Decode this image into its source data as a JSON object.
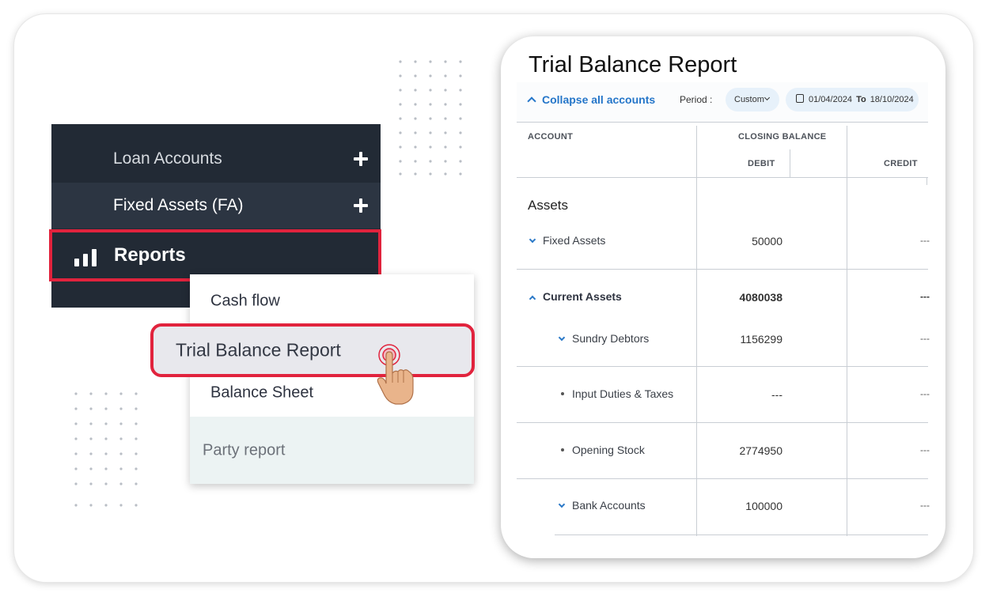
{
  "sidebar": {
    "items": [
      {
        "label": "Loan Accounts"
      },
      {
        "label": "Fixed Assets (FA)"
      },
      {
        "label": "Reports"
      }
    ]
  },
  "dropdown": {
    "items": [
      {
        "label": "Cash flow"
      },
      {
        "label": "Trial Balance Report"
      },
      {
        "label": "Balance Sheet"
      },
      {
        "label": "Party report"
      }
    ]
  },
  "report": {
    "title": "Trial Balance Report",
    "collapse_label": "Collapse all accounts",
    "period_label": "Period :",
    "period_value": "Custom",
    "date_from": "01/04/2024",
    "date_to_label": "To",
    "date_to": "18/10/2024",
    "headers": {
      "account": "ACCOUNT",
      "closing_balance": "CLOSING BALANCE",
      "debit": "DEBIT",
      "credit": "CREDIT"
    },
    "section": "Assets",
    "rows": [
      {
        "label": "Fixed Assets",
        "debit": "50000",
        "credit": "---"
      },
      {
        "label": "Current Assets",
        "debit": "4080038",
        "credit": "---"
      },
      {
        "label": "Sundry Debtors",
        "debit": "1156299",
        "credit": "---"
      },
      {
        "label": "Input Duties & Taxes",
        "debit": "---",
        "credit": "---"
      },
      {
        "label": "Opening Stock",
        "debit": "2774950",
        "credit": "---"
      },
      {
        "label": "Bank Accounts",
        "debit": "100000",
        "credit": "---"
      }
    ]
  },
  "colors": {
    "sidebar_bg": "#222a35",
    "highlight_red": "#e1233d",
    "link_blue": "#2576c9",
    "pill_bg": "#e7f1fa"
  }
}
